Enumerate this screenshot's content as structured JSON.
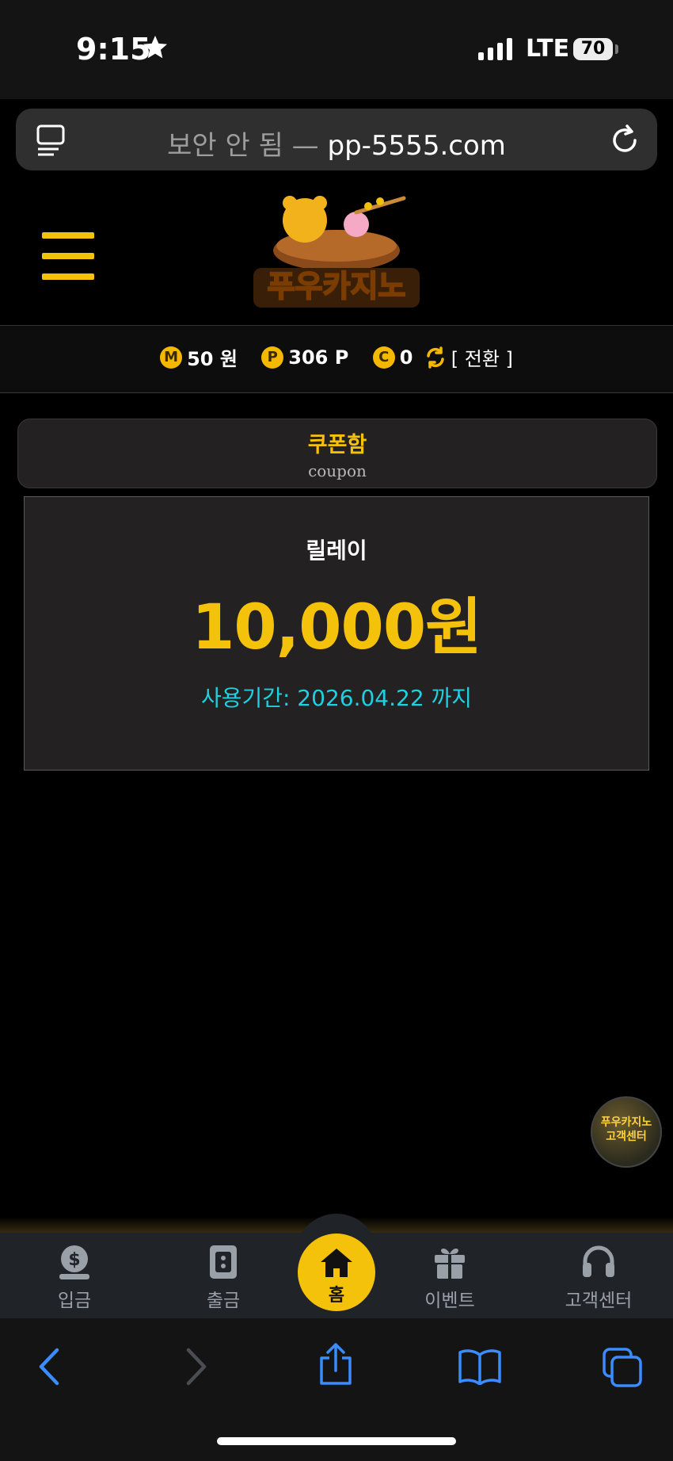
{
  "status_bar": {
    "time": "9:15",
    "network": "LTE",
    "battery": "70"
  },
  "browser": {
    "security_label": "보안 안 됨 —",
    "domain": "pp-5555.com"
  },
  "site": {
    "logo_text": "푸우카지노",
    "balance": {
      "money_icon": "M",
      "money_value": "50 원",
      "point_icon": "P",
      "point_value": "306 P",
      "comp_icon": "C",
      "comp_value": "0",
      "convert_label": "[ 전환 ]"
    }
  },
  "coupon_tab": {
    "title": "쿠폰함",
    "subtitle": "coupon"
  },
  "coupon": {
    "name": "릴레이",
    "amount": "10,000원",
    "expiry": "사용기간: 2026.04.22 까지"
  },
  "cs_badge": {
    "line1": "푸우카지노",
    "line2": "고객센터"
  },
  "bottom_nav": {
    "items": [
      {
        "label": "입금",
        "icon": "deposit-icon"
      },
      {
        "label": "출금",
        "icon": "withdraw-icon"
      },
      {
        "label": "홈",
        "icon": "home-icon"
      },
      {
        "label": "이벤트",
        "icon": "gift-icon"
      },
      {
        "label": "고객센터",
        "icon": "headset-icon"
      }
    ]
  },
  "colors": {
    "accent": "#f5c20b",
    "expiry": "#1fd1e0",
    "safari_blue": "#3a8cff"
  }
}
